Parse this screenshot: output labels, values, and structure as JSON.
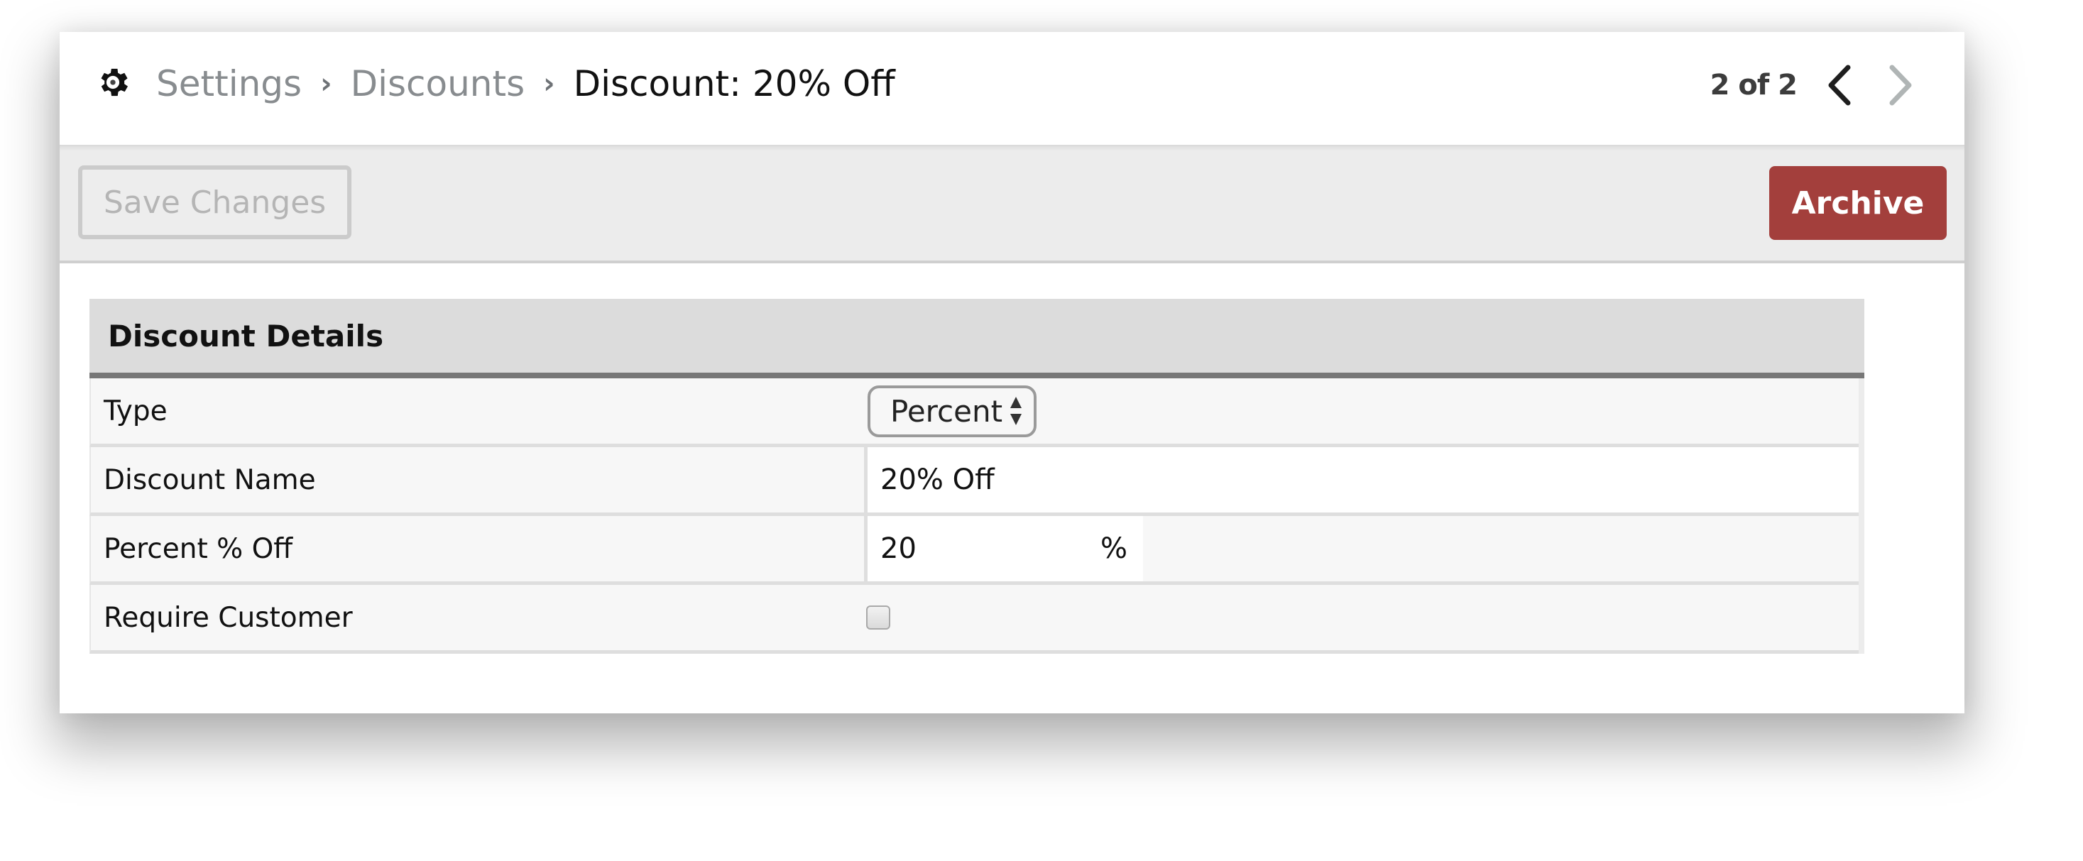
{
  "header": {
    "breadcrumb": [
      {
        "label": "Settings"
      },
      {
        "label": "Discounts"
      }
    ],
    "separator": "›",
    "current": "Discount: 20% Off",
    "icon": "gear-icon",
    "pager": {
      "text": "2 of 2",
      "prev_icon": "chevron-left-icon",
      "next_icon": "chevron-right-icon",
      "next_disabled": true
    }
  },
  "toolbar": {
    "save_label": "Save Changes",
    "save_disabled": true,
    "archive_label": "Archive"
  },
  "colors": {
    "archive": "#a33f3c",
    "header_rule": "#777777",
    "disabled_chevron": "#b0b5b5"
  },
  "details": {
    "title": "Discount Details",
    "rows": [
      {
        "label": "Type",
        "control": "select",
        "value": "Percent"
      },
      {
        "label": "Discount Name",
        "control": "text",
        "value": "20% Off"
      },
      {
        "label": "Percent % Off",
        "control": "number",
        "value": "20",
        "suffix": "%"
      },
      {
        "label": "Require Customer",
        "control": "checkbox",
        "checked": false
      }
    ]
  }
}
